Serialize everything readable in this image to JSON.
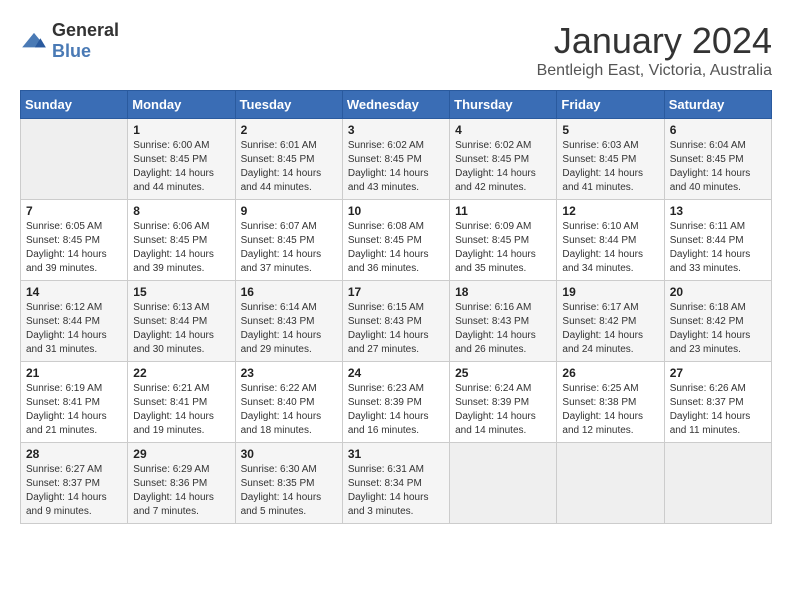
{
  "header": {
    "logo_general": "General",
    "logo_blue": "Blue",
    "month": "January 2024",
    "location": "Bentleigh East, Victoria, Australia"
  },
  "columns": [
    "Sunday",
    "Monday",
    "Tuesday",
    "Wednesday",
    "Thursday",
    "Friday",
    "Saturday"
  ],
  "weeks": [
    [
      {
        "day": "",
        "info": ""
      },
      {
        "day": "1",
        "info": "Sunrise: 6:00 AM\nSunset: 8:45 PM\nDaylight: 14 hours\nand 44 minutes."
      },
      {
        "day": "2",
        "info": "Sunrise: 6:01 AM\nSunset: 8:45 PM\nDaylight: 14 hours\nand 44 minutes."
      },
      {
        "day": "3",
        "info": "Sunrise: 6:02 AM\nSunset: 8:45 PM\nDaylight: 14 hours\nand 43 minutes."
      },
      {
        "day": "4",
        "info": "Sunrise: 6:02 AM\nSunset: 8:45 PM\nDaylight: 14 hours\nand 42 minutes."
      },
      {
        "day": "5",
        "info": "Sunrise: 6:03 AM\nSunset: 8:45 PM\nDaylight: 14 hours\nand 41 minutes."
      },
      {
        "day": "6",
        "info": "Sunrise: 6:04 AM\nSunset: 8:45 PM\nDaylight: 14 hours\nand 40 minutes."
      }
    ],
    [
      {
        "day": "7",
        "info": "Sunrise: 6:05 AM\nSunset: 8:45 PM\nDaylight: 14 hours\nand 39 minutes."
      },
      {
        "day": "8",
        "info": "Sunrise: 6:06 AM\nSunset: 8:45 PM\nDaylight: 14 hours\nand 39 minutes."
      },
      {
        "day": "9",
        "info": "Sunrise: 6:07 AM\nSunset: 8:45 PM\nDaylight: 14 hours\nand 37 minutes."
      },
      {
        "day": "10",
        "info": "Sunrise: 6:08 AM\nSunset: 8:45 PM\nDaylight: 14 hours\nand 36 minutes."
      },
      {
        "day": "11",
        "info": "Sunrise: 6:09 AM\nSunset: 8:45 PM\nDaylight: 14 hours\nand 35 minutes."
      },
      {
        "day": "12",
        "info": "Sunrise: 6:10 AM\nSunset: 8:44 PM\nDaylight: 14 hours\nand 34 minutes."
      },
      {
        "day": "13",
        "info": "Sunrise: 6:11 AM\nSunset: 8:44 PM\nDaylight: 14 hours\nand 33 minutes."
      }
    ],
    [
      {
        "day": "14",
        "info": "Sunrise: 6:12 AM\nSunset: 8:44 PM\nDaylight: 14 hours\nand 31 minutes."
      },
      {
        "day": "15",
        "info": "Sunrise: 6:13 AM\nSunset: 8:44 PM\nDaylight: 14 hours\nand 30 minutes."
      },
      {
        "day": "16",
        "info": "Sunrise: 6:14 AM\nSunset: 8:43 PM\nDaylight: 14 hours\nand 29 minutes."
      },
      {
        "day": "17",
        "info": "Sunrise: 6:15 AM\nSunset: 8:43 PM\nDaylight: 14 hours\nand 27 minutes."
      },
      {
        "day": "18",
        "info": "Sunrise: 6:16 AM\nSunset: 8:43 PM\nDaylight: 14 hours\nand 26 minutes."
      },
      {
        "day": "19",
        "info": "Sunrise: 6:17 AM\nSunset: 8:42 PM\nDaylight: 14 hours\nand 24 minutes."
      },
      {
        "day": "20",
        "info": "Sunrise: 6:18 AM\nSunset: 8:42 PM\nDaylight: 14 hours\nand 23 minutes."
      }
    ],
    [
      {
        "day": "21",
        "info": "Sunrise: 6:19 AM\nSunset: 8:41 PM\nDaylight: 14 hours\nand 21 minutes."
      },
      {
        "day": "22",
        "info": "Sunrise: 6:21 AM\nSunset: 8:41 PM\nDaylight: 14 hours\nand 19 minutes."
      },
      {
        "day": "23",
        "info": "Sunrise: 6:22 AM\nSunset: 8:40 PM\nDaylight: 14 hours\nand 18 minutes."
      },
      {
        "day": "24",
        "info": "Sunrise: 6:23 AM\nSunset: 8:39 PM\nDaylight: 14 hours\nand 16 minutes."
      },
      {
        "day": "25",
        "info": "Sunrise: 6:24 AM\nSunset: 8:39 PM\nDaylight: 14 hours\nand 14 minutes."
      },
      {
        "day": "26",
        "info": "Sunrise: 6:25 AM\nSunset: 8:38 PM\nDaylight: 14 hours\nand 12 minutes."
      },
      {
        "day": "27",
        "info": "Sunrise: 6:26 AM\nSunset: 8:37 PM\nDaylight: 14 hours\nand 11 minutes."
      }
    ],
    [
      {
        "day": "28",
        "info": "Sunrise: 6:27 AM\nSunset: 8:37 PM\nDaylight: 14 hours\nand 9 minutes."
      },
      {
        "day": "29",
        "info": "Sunrise: 6:29 AM\nSunset: 8:36 PM\nDaylight: 14 hours\nand 7 minutes."
      },
      {
        "day": "30",
        "info": "Sunrise: 6:30 AM\nSunset: 8:35 PM\nDaylight: 14 hours\nand 5 minutes."
      },
      {
        "day": "31",
        "info": "Sunrise: 6:31 AM\nSunset: 8:34 PM\nDaylight: 14 hours\nand 3 minutes."
      },
      {
        "day": "",
        "info": ""
      },
      {
        "day": "",
        "info": ""
      },
      {
        "day": "",
        "info": ""
      }
    ]
  ]
}
